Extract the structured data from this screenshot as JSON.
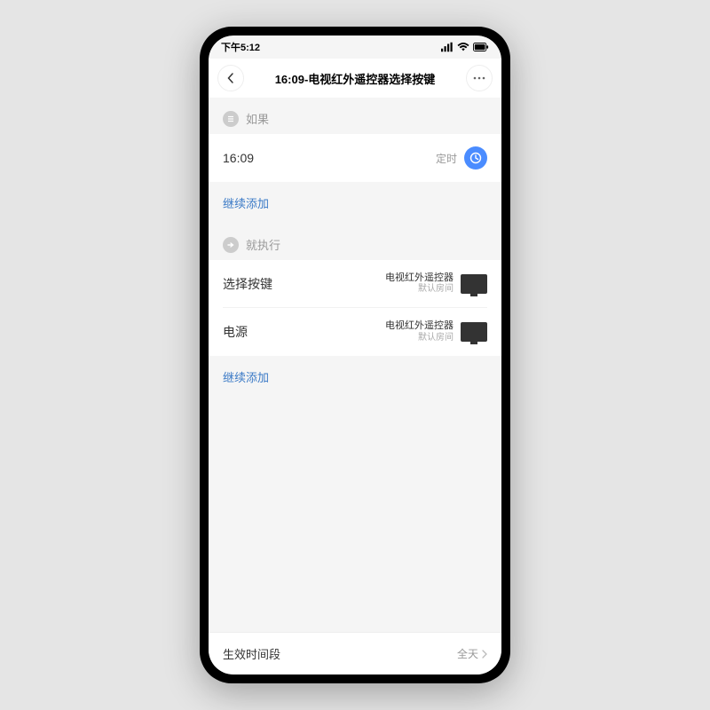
{
  "status": {
    "time": "下午5:12"
  },
  "header": {
    "title": "16:09-电视红外遥控器选择按键"
  },
  "section_if": {
    "label": "如果"
  },
  "trigger": {
    "time": "16:09",
    "type": "定时"
  },
  "add_more_if": "继续添加",
  "section_then": {
    "label": "就执行"
  },
  "actions": [
    {
      "label": "选择按键",
      "device": "电视红外遥控器",
      "room": "默认房间"
    },
    {
      "label": "电源",
      "device": "电视红外遥控器",
      "room": "默认房间"
    }
  ],
  "add_more_then": "继续添加",
  "effective_period": {
    "label": "生效时间段",
    "value": "全天"
  }
}
